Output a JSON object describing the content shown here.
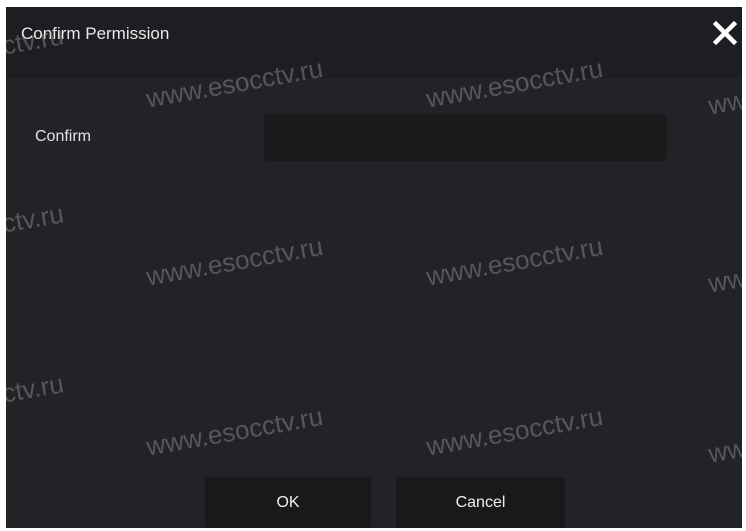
{
  "dialog": {
    "title": "Confirm Permission",
    "close_icon": "close-icon"
  },
  "form": {
    "confirm_label": "Confirm",
    "confirm_value": ""
  },
  "buttons": {
    "ok_label": "OK",
    "cancel_label": "Cancel"
  },
  "watermark": {
    "full": "www.esocctv.ru",
    "partial_left": "ctv.ru",
    "partial_right": "ww"
  },
  "colors": {
    "dialog_bg": "#222326",
    "titlebar_bg": "#1d1e21",
    "input_bg": "#1a1b1d",
    "button_bg": "#18191b",
    "text": "#e9e9e9"
  }
}
